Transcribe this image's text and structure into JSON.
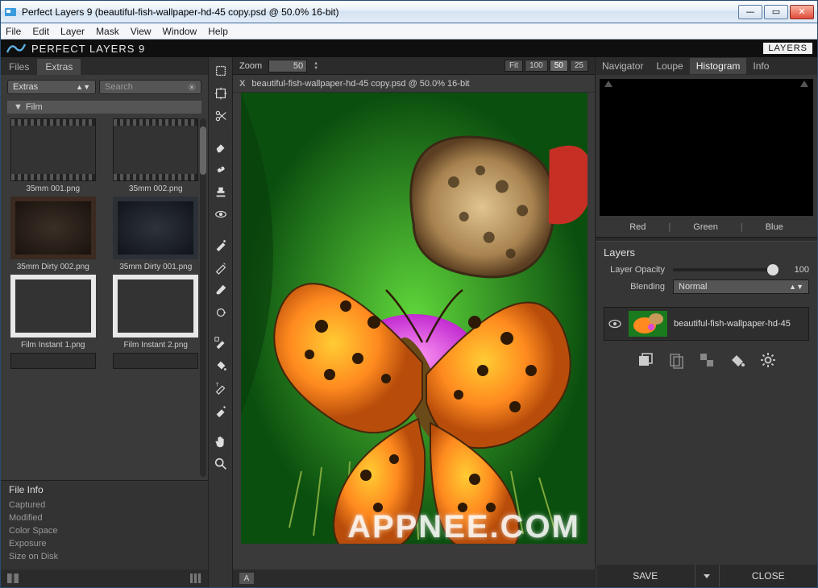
{
  "window": {
    "title": "Perfect Layers 9 (beautiful-fish-wallpaper-hd-45 copy.psd @ 50.0% 16-bit)"
  },
  "menubar": [
    "File",
    "Edit",
    "Layer",
    "Mask",
    "View",
    "Window",
    "Help"
  ],
  "brandbar": {
    "brand": "PERFECT LAYERS 9",
    "layers_button": "LAYERS"
  },
  "left": {
    "tabs": {
      "files": "Files",
      "extras": "Extras"
    },
    "filter_dropdown": "Extras",
    "search_placeholder": "Search",
    "section": "Film",
    "thumbs": [
      {
        "label": "35mm 001.png",
        "style": "film"
      },
      {
        "label": "35mm 002.png",
        "style": "film"
      },
      {
        "label": "35mm Dirty 002.png",
        "style": "dirty1"
      },
      {
        "label": "35mm Dirty  001.png",
        "style": "dirty2"
      },
      {
        "label": "Film Instant 1.png",
        "style": "instant"
      },
      {
        "label": "Film Instant 2.png",
        "style": "instant"
      }
    ],
    "file_info": {
      "title": "File Info",
      "rows": [
        "Captured",
        "Modified",
        "Color Space",
        "Exposure",
        "Size on Disk"
      ]
    }
  },
  "tools": [
    "crop",
    "transform",
    "scissors",
    "eraser",
    "heal",
    "stamp",
    "eye",
    "sep",
    "retouch-face",
    "retouch-skin",
    "brush",
    "clone",
    "sep",
    "mask-brush",
    "mask-bucket",
    "mask-shape",
    "text",
    "sep",
    "hand",
    "zoom"
  ],
  "center": {
    "zoom_label": "Zoom",
    "zoom_value": "50",
    "presets": [
      "Fit",
      "100",
      "50",
      "25"
    ],
    "active_preset": "50",
    "doc_tab": "beautiful-fish-wallpaper-hd-45 copy.psd @ 50.0% 16-bit",
    "bottom_letter": "A",
    "watermark": "APPNEE.COM"
  },
  "right": {
    "tabs": [
      "Navigator",
      "Loupe",
      "Histogram",
      "Info"
    ],
    "active_tab": "Histogram",
    "channels": [
      "Red",
      "Green",
      "Blue"
    ],
    "layers_title": "Layers",
    "opacity_label": "Layer Opacity",
    "opacity_value": "100",
    "blending_label": "Blending",
    "blending_value": "Normal",
    "layer_name": "beautiful-fish-wallpaper-hd-45",
    "save_label": "SAVE",
    "close_label": "CLOSE"
  }
}
